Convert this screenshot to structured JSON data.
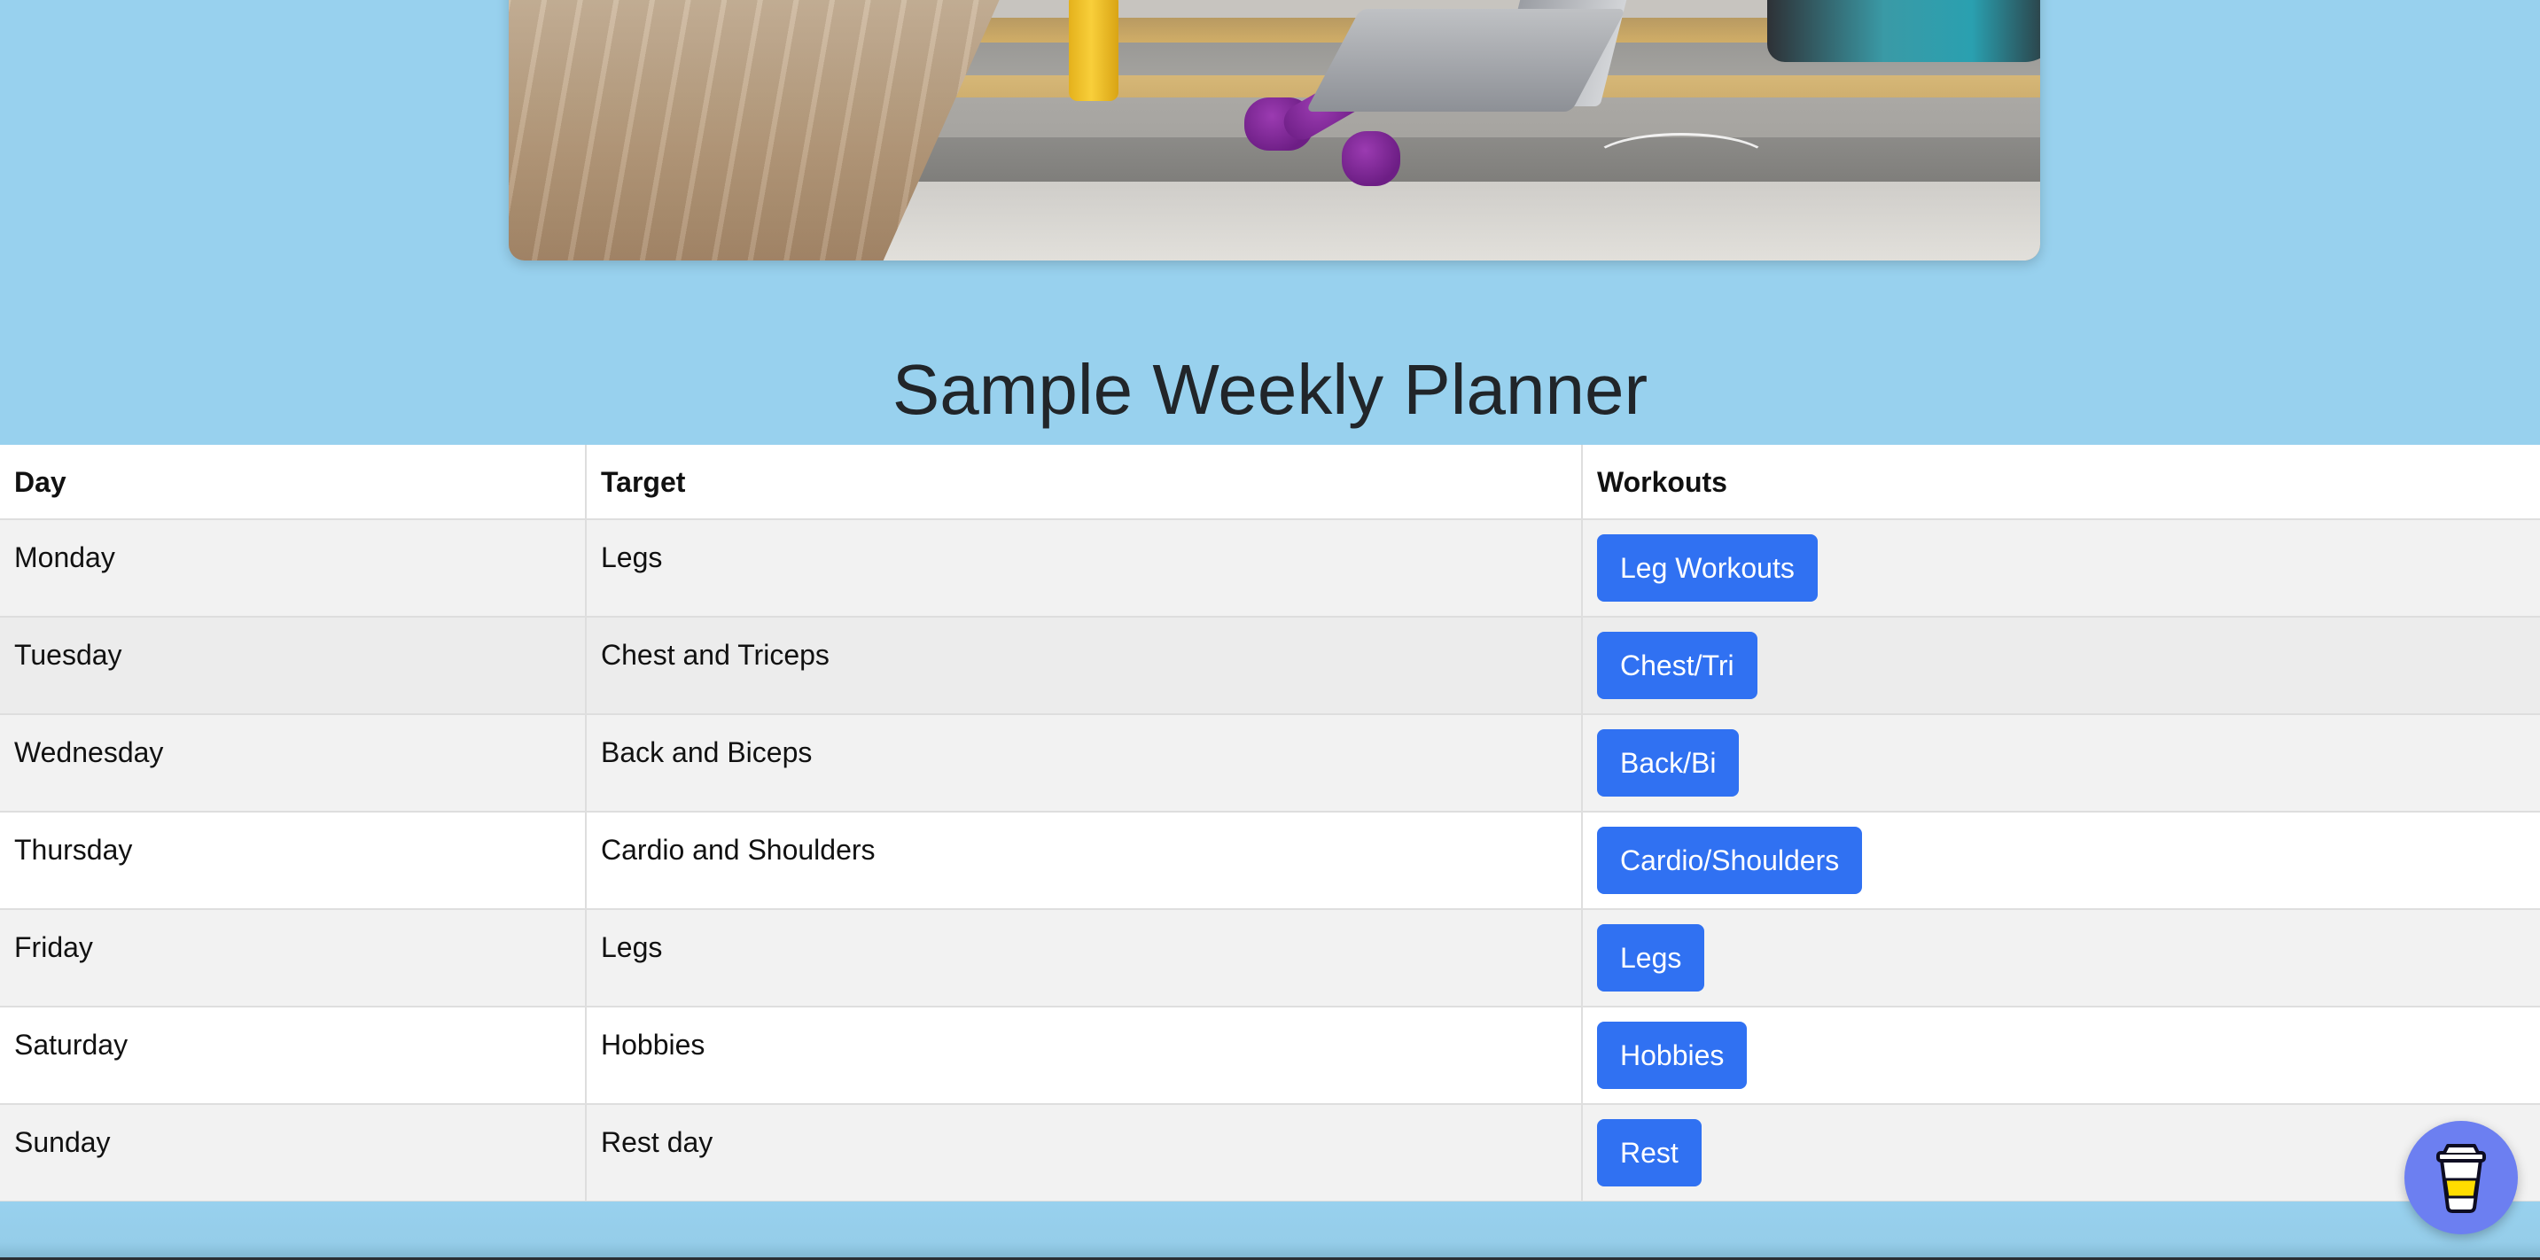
{
  "title": "Sample Weekly Planner",
  "table": {
    "headers": [
      "Day",
      "Target",
      "Workouts"
    ],
    "rows": [
      {
        "day": "Monday",
        "target": "Legs",
        "workout": "Leg Workouts"
      },
      {
        "day": "Tuesday",
        "target": "Chest and Triceps",
        "workout": "Chest/Tri"
      },
      {
        "day": "Wednesday",
        "target": "Back and Biceps",
        "workout": "Back/Bi"
      },
      {
        "day": "Thursday",
        "target": "Cardio and Shoulders",
        "workout": "Cardio/Shoulders"
      },
      {
        "day": "Friday",
        "target": "Legs",
        "workout": "Legs"
      },
      {
        "day": "Saturday",
        "target": "Hobbies",
        "workout": "Hobbies"
      },
      {
        "day": "Sunday",
        "target": "Rest day",
        "workout": "Rest"
      }
    ]
  },
  "colors": {
    "background": "#98d1ee",
    "button": "#3071f2",
    "fab": "#6c7ff1",
    "title": "#212529"
  },
  "icons": {
    "hero": "workout-photo",
    "fab": "coffee-cup-icon"
  }
}
